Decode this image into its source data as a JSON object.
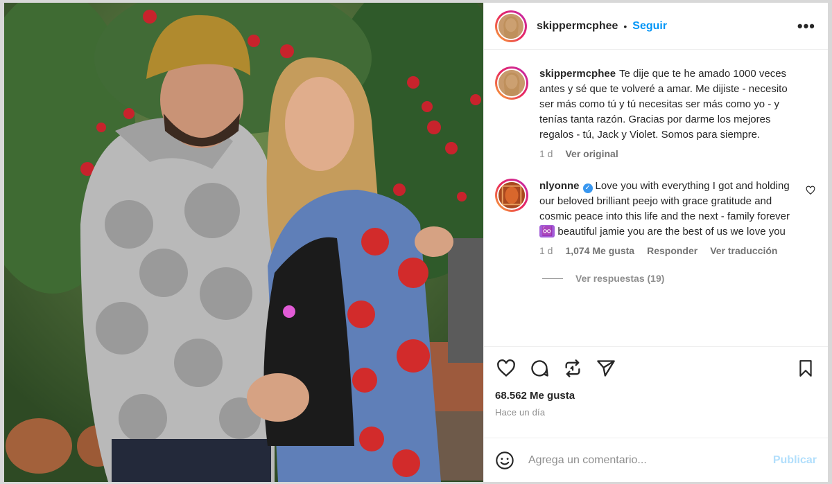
{
  "post": {
    "author": "skippermcphee",
    "separator": "•",
    "follow_label": "Seguir",
    "more_label": "•••",
    "photo_alt": "Foto de la publicación"
  },
  "caption": {
    "username": "skippermcphee",
    "text": "Te dije que te he amado 1000 veces antes y sé que te volveré a amar. Me dijiste - necesito ser más como tú y tú necesitas ser más como yo - y tenías tanta razón. Gracias por darme los mejores regalos - tú, Jack y Violet. Somos para siempre.",
    "age": "1 d",
    "see_original": "Ver original"
  },
  "comment": {
    "username": "nlyonne",
    "verified_glyph": "✓",
    "text_before": "Love you with everything I got and holding our beloved brilliant peejo with grace gratitude and cosmic peace into this life and the next - family forever",
    "emoji": "♾️",
    "text_after": "beautiful jamie you are the best of us we love you",
    "age": "1 d",
    "likes": "1,074 Me gusta",
    "reply": "Responder",
    "see_translation": "Ver traducción",
    "view_replies": "Ver respuestas (19)"
  },
  "engagement": {
    "likes": "68.562 Me gusta",
    "time_ago": "Hace un día"
  },
  "add_comment": {
    "placeholder": "Agrega un comentario...",
    "post_label": "Publicar"
  },
  "colors": {
    "accent": "#0095f6",
    "post_disabled": "#b2dffc",
    "muted": "#8e8e8e"
  }
}
